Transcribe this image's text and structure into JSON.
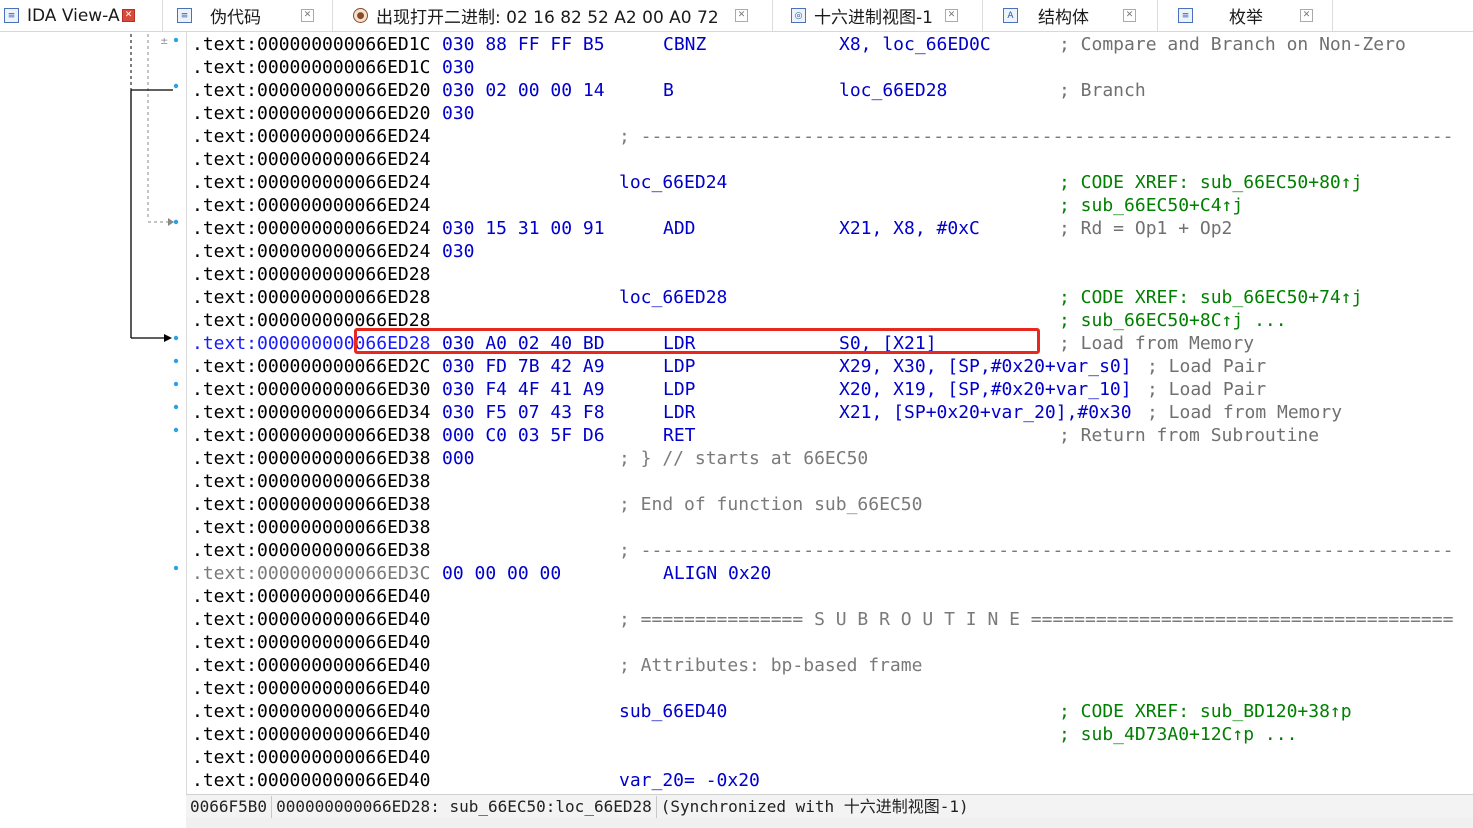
{
  "tabs": [
    {
      "label": "IDA View-A",
      "icon": "disassembly-view-icon",
      "active": true
    },
    {
      "label": "伪代码",
      "icon": "pseudocode-icon",
      "active": false
    },
    {
      "label": "出现打开二进制: 02 16 82 52 A2 00 A0 72",
      "icon": "search-result-icon",
      "active": false
    },
    {
      "label": "十六进制视图-1",
      "icon": "hex-view-icon",
      "active": false
    },
    {
      "label": "结构体",
      "icon": "structures-icon",
      "active": false
    },
    {
      "label": "枚举",
      "icon": "enums-icon",
      "active": false
    }
  ],
  "lines": [
    {
      "addr": ".text:000000000066ED1C",
      "bytes": "030 88 FF FF B5",
      "mnem": "CBNZ",
      "opnd": "X8, loc_66ED0C",
      "cmt": "; Compare and Branch on Non-Zero"
    },
    {
      "addr": ".text:000000000066ED1C",
      "bytes": "030"
    },
    {
      "addr": ".text:000000000066ED20",
      "bytes": "030 02 00 00 14",
      "mnem": "B",
      "opnd": "loc_66ED28",
      "cmt": "; Branch"
    },
    {
      "addr": ".text:000000000066ED20",
      "bytes": "030"
    },
    {
      "addr": ".text:000000000066ED24",
      "sep": "; ---------------------------------------------------------------------------"
    },
    {
      "addr": ".text:000000000066ED24"
    },
    {
      "addr": ".text:000000000066ED24",
      "label": "loc_66ED24",
      "xref": "; CODE XREF: sub_66EC50+80↑j"
    },
    {
      "addr": ".text:000000000066ED24",
      "xref": "; sub_66EC50+C4↑j"
    },
    {
      "addr": ".text:000000000066ED24",
      "bytes": "030 15 31 00 91",
      "mnem": "ADD",
      "opnd": "X21, X8, #0xC",
      "cmt": "; Rd = Op1 + Op2"
    },
    {
      "addr": ".text:000000000066ED24",
      "bytes": "030"
    },
    {
      "addr": ".text:000000000066ED28"
    },
    {
      "addr": ".text:000000000066ED28",
      "label": "loc_66ED28",
      "xref": "; CODE XREF: sub_66EC50+74↑j"
    },
    {
      "addr": ".text:000000000066ED28",
      "xref": "; sub_66EC50+8C↑j ..."
    },
    {
      "addr": ".text:000000000066ED28",
      "bytes": "030 A0 02 40 BD",
      "mnem": "LDR",
      "opnd": "S0, [X21]",
      "cmt": "; Load from Memory",
      "highlight": true
    },
    {
      "addr": ".text:000000000066ED2C",
      "bytes": "030 FD 7B 42 A9",
      "mnem": "LDP",
      "opnd": "X29, X30, [SP,#0x20+var_s0]",
      "cmt": "; Load Pair"
    },
    {
      "addr": ".text:000000000066ED30",
      "bytes": "030 F4 4F 41 A9",
      "mnem": "LDP",
      "opnd": "X20, X19, [SP,#0x20+var_10]",
      "cmt": "; Load Pair"
    },
    {
      "addr": ".text:000000000066ED34",
      "bytes": "030 F5 07 43 F8",
      "mnem": "LDR",
      "opnd": "X21, [SP+0x20+var_20],#0x30",
      "cmt": "; Load from Memory"
    },
    {
      "addr": ".text:000000000066ED38",
      "bytes": "000 C0 03 5F D6",
      "mnem": "RET",
      "cmt": "; Return from Subroutine"
    },
    {
      "addr": ".text:000000000066ED38",
      "bytes": "000",
      "plain": "; } // starts at 66EC50"
    },
    {
      "addr": ".text:000000000066ED38"
    },
    {
      "addr": ".text:000000000066ED38",
      "plain": "; End of function sub_66EC50"
    },
    {
      "addr": ".text:000000000066ED38"
    },
    {
      "addr": ".text:000000000066ED38",
      "sep": "; ---------------------------------------------------------------------------"
    },
    {
      "addr": ".text:000000000066ED3C",
      "bytes": "00 00 00 00",
      "mnem": "ALIGN 0x20",
      "gray": true
    },
    {
      "addr": ".text:000000000066ED40"
    },
    {
      "addr": ".text:000000000066ED40",
      "plain": "; =============== S U B R O U T I N E ======================================="
    },
    {
      "addr": ".text:000000000066ED40"
    },
    {
      "addr": ".text:000000000066ED40",
      "plain": "; Attributes: bp-based frame"
    },
    {
      "addr": ".text:000000000066ED40"
    },
    {
      "addr": ".text:000000000066ED40",
      "label": "sub_66ED40",
      "xref": "; CODE XREF: sub_BD120+38↑p"
    },
    {
      "addr": ".text:000000000066ED40",
      "xref": "; sub_4D73A0+12C↑p ..."
    },
    {
      "addr": ".text:000000000066ED40"
    },
    {
      "addr": ".text:000000000066ED40",
      "label": "var_20= -0x20"
    }
  ],
  "status": {
    "offset": "0066F5B0",
    "location": "000000000066ED28: sub_66EC50:loc_66ED28",
    "sync": "(Synchronized with 十六进制视图-1)"
  },
  "colors": {
    "code_blue": "#0000cc",
    "comment_gray": "#707070",
    "xref_green": "#008000",
    "highlight_red": "#e8281e",
    "breakpoint_dot": "#2aa0e8"
  }
}
